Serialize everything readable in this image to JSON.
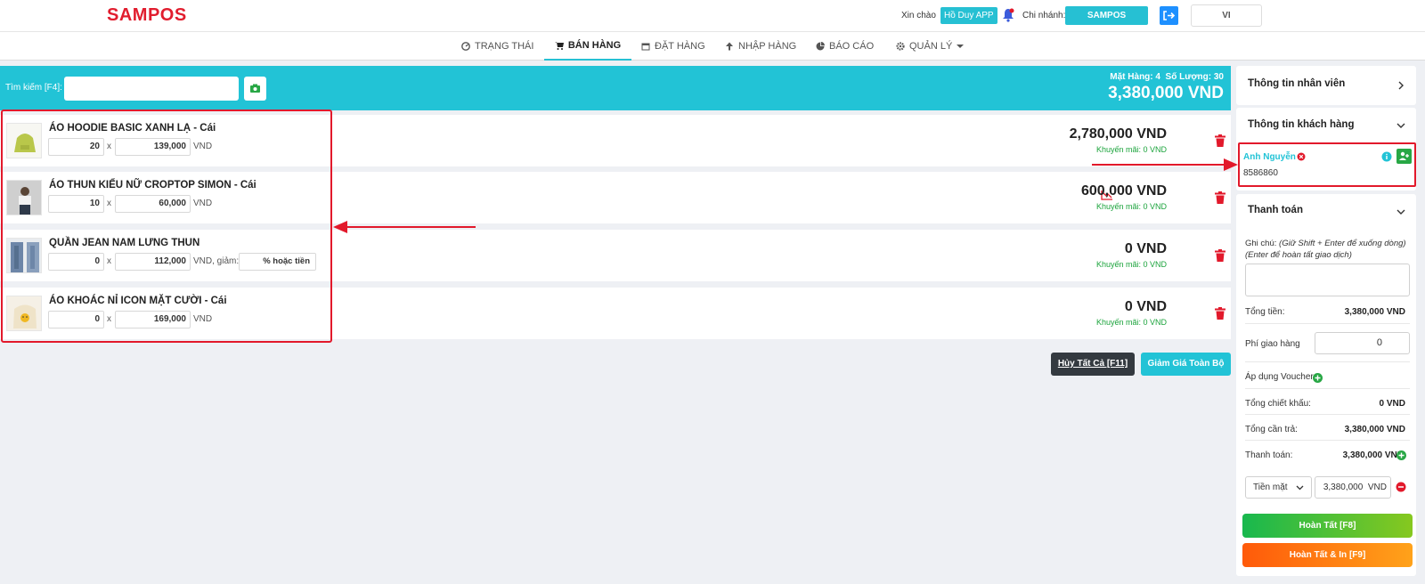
{
  "header": {
    "logo": "SAMPOS",
    "greeting": "Xin chào",
    "user": "Hồ Duy APP",
    "branch_label": "Chi nhánh:",
    "branch": "SAMPOS",
    "language": "VI"
  },
  "nav": [
    {
      "label": "TRẠNG THÁI",
      "icon": "dashboard-icon"
    },
    {
      "label": "BÁN HÀNG",
      "icon": "cart-icon",
      "active": true
    },
    {
      "label": "ĐẶT HÀNG",
      "icon": "calendar-icon"
    },
    {
      "label": "NHẬP HÀNG",
      "icon": "arrow-up-icon"
    },
    {
      "label": "BÁO CÁO",
      "icon": "pie-chart-icon"
    },
    {
      "label": "QUẢN LÝ",
      "icon": "gear-icon"
    }
  ],
  "search": {
    "label": "Tìm kiếm [F4]:",
    "placeholder": ""
  },
  "summary": {
    "items_label": "Mặt Hàng:",
    "items_count": "4",
    "qty_label": "Số Lượng:",
    "qty_count": "30",
    "total": "3,380,000 VND"
  },
  "cart": [
    {
      "name": "ÁO HOODIE BASIC XANH LẠ - Cái",
      "qty": "20",
      "price": "139,000",
      "unit": "VND",
      "line_total": "2,780,000 VND",
      "promo": "Khuyến mãi: 0 VND"
    },
    {
      "name": "ÁO THUN KIỂU NỮ CROPTOP SIMON - Cái",
      "qty": "10",
      "price": "60,000",
      "unit": "VND",
      "line_total": "600,000 VND",
      "promo": "Khuyến mãi: 0 VND"
    },
    {
      "name": "QUẦN JEAN NAM LƯNG THUN",
      "qty": "0",
      "price": "112,000",
      "unit": "VND, giảm:",
      "discount": "% hoặc tiền",
      "line_total": "0 VND",
      "promo": "Khuyến mãi: 0 VND"
    },
    {
      "name": "ÁO KHOÁC NỈ ICON MẶT CƯỜI - Cái",
      "qty": "0",
      "price": "169,000",
      "unit": "VND",
      "line_total": "0 VND",
      "promo": "Khuyến mãi: 0 VND"
    }
  ],
  "times_sign": "x",
  "actions": {
    "cancel_all": "Hủy Tất Cả [F11]",
    "discount_all": "Giảm Giá Toàn Bộ"
  },
  "panel": {
    "staff_title": "Thông tin nhân viên",
    "customer_title": "Thông tin khách hàng",
    "customer_name": "Anh Nguyễn",
    "customer_phone": "8586860",
    "payment_title": "Thanh toán",
    "note_label": "Ghi chú:",
    "note_hint1": "(Giữ Shift + Enter để xuống dòng)",
    "note_hint2": "(Enter để hoàn tất giao dịch)",
    "total_label": "Tổng tiền:",
    "total_value": "3,380,000 VND",
    "shipping_label": "Phí giao hàng",
    "shipping_value": "0",
    "voucher_label": "Áp dụng Voucher",
    "discount_label": "Tổng chiết khấu:",
    "discount_value": "0 VND",
    "due_label": "Tổng cần trả:",
    "due_value": "3,380,000 VND",
    "paid_label": "Thanh toán:",
    "paid_value": "3,380,000 VND",
    "method": "Tiền mặt",
    "method_amount": "3,380,000",
    "method_unit": "VND",
    "finish": "Hoàn Tất [F8]",
    "finish_print": "Hoàn Tất & In [F9]"
  },
  "colors": {
    "brand_red": "#e11d2e",
    "accent_cyan": "#22c3d6",
    "promo_green": "#1aa33b",
    "danger": "#e2192b"
  }
}
